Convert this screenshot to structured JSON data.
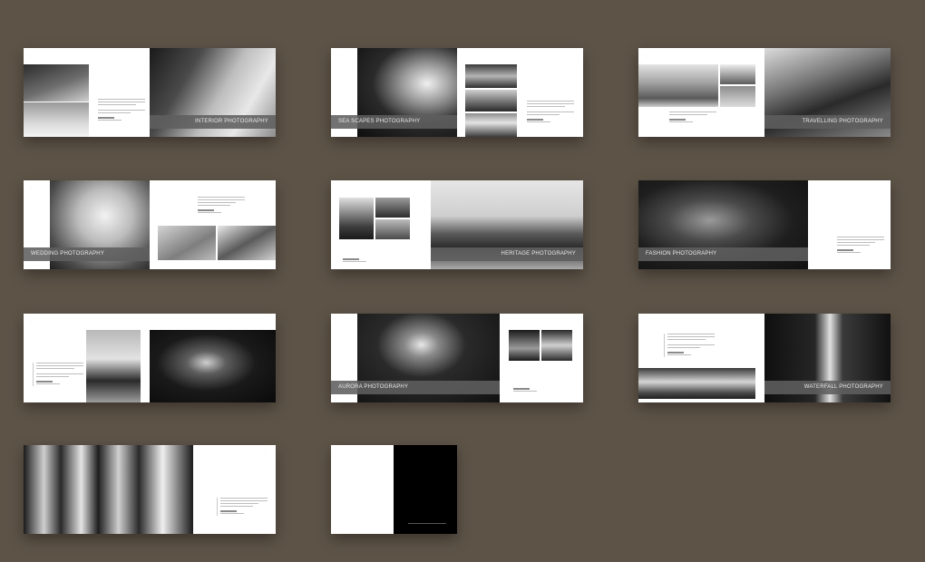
{
  "spreads": [
    {
      "id": "interior",
      "caption": "INTERIOR PHOTOGRAPHY"
    },
    {
      "id": "seascapes",
      "caption": "SEA SCAPES PHOTOGRAPHY"
    },
    {
      "id": "travelling",
      "caption": "TRAVELLING PHOTOGRAPHY"
    },
    {
      "id": "wedding",
      "caption": "WEDDING PHOTOGRAPHY"
    },
    {
      "id": "heritage",
      "caption": "HERITAGE PHOTOGRAPHY"
    },
    {
      "id": "fashion",
      "caption": "FASHION PHOTOGRAPHY"
    },
    {
      "id": "aurora",
      "caption": "AURORA PHOTOGRAPHY"
    },
    {
      "id": "waterfall",
      "caption": "WATERFALL PHOTOGRAPHY"
    }
  ],
  "colors": {
    "background": "#5d5347",
    "page": "#ffffff",
    "caption_bar": "#5f5f5f",
    "back_cover": "#000000"
  }
}
